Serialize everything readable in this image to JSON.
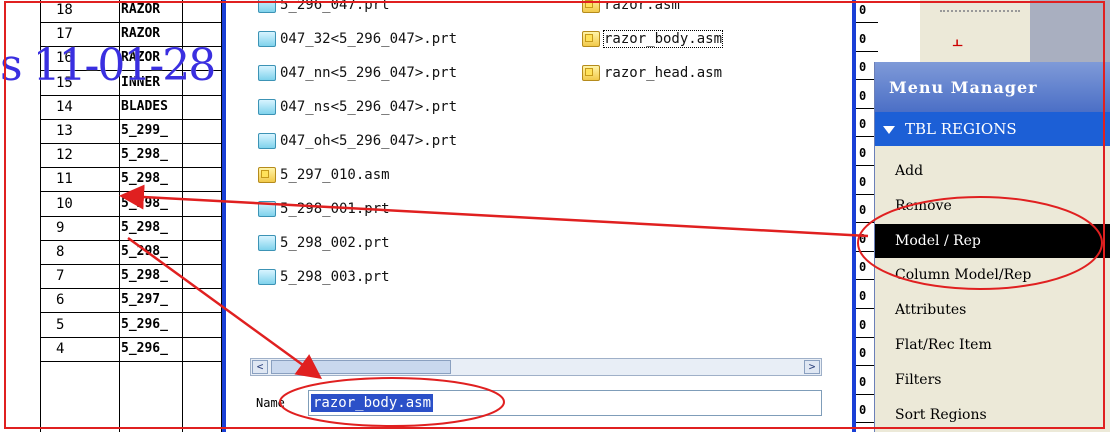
{
  "watermark": "s 11-01-28",
  "table_rows": [
    {
      "num": "18",
      "text": "RAZOR"
    },
    {
      "num": "17",
      "text": "RAZOR"
    },
    {
      "num": "16",
      "text": "RAZOR"
    },
    {
      "num": "15",
      "text": "INNER"
    },
    {
      "num": "14",
      "text": "BLADES"
    },
    {
      "num": "13",
      "text": "5_299_"
    },
    {
      "num": "12",
      "text": "5_298_"
    },
    {
      "num": "11",
      "text": "5_298_"
    },
    {
      "num": "10",
      "text": "5_298_"
    },
    {
      "num": "9",
      "text": "5_298_"
    },
    {
      "num": "8",
      "text": "5_298_"
    },
    {
      "num": "7",
      "text": "5_298_"
    },
    {
      "num": "6",
      "text": "5_297_"
    },
    {
      "num": "5",
      "text": "5_296_"
    },
    {
      "num": "4",
      "text": "5_296_"
    }
  ],
  "files_col1": [
    {
      "name": "5_296_047.prt",
      "type": "prt"
    },
    {
      "name": "047_32<5_296_047>.prt",
      "type": "prt"
    },
    {
      "name": "047_nn<5_296_047>.prt",
      "type": "prt"
    },
    {
      "name": "047_ns<5_296_047>.prt",
      "type": "prt"
    },
    {
      "name": "047_oh<5_296_047>.prt",
      "type": "prt"
    },
    {
      "name": "5_297_010.asm",
      "type": "asm"
    },
    {
      "name": "5_298_001.prt",
      "type": "prt"
    },
    {
      "name": "5_298_002.prt",
      "type": "prt"
    },
    {
      "name": "5_298_003.prt",
      "type": "prt"
    }
  ],
  "files_col2": [
    {
      "name": "razor.asm",
      "type": "asm"
    },
    {
      "name": "razor_body.asm",
      "type": "asm"
    },
    {
      "name": "razor_head.asm",
      "type": "asm"
    }
  ],
  "name_field": {
    "label": "Name",
    "value": "razor_body.asm"
  },
  "right_col_digits": [
    "0",
    "0",
    "0",
    "0",
    "0",
    "0",
    "0",
    "0",
    "0",
    "0",
    "0",
    "0",
    "0",
    "0",
    "0"
  ],
  "menu": {
    "title": "Menu Manager",
    "section": "TBL REGIONS",
    "items": [
      "Add",
      "Remove",
      "Model / Rep",
      "Column Model/Rep",
      "Attributes",
      "Flat/Rec Item",
      "Filters",
      "Sort Regions"
    ],
    "highlighted_index": 2
  },
  "colors": {
    "accent": "#1c5fd6",
    "annotation": "#e02020"
  },
  "scroll": {
    "left": "<",
    "right": ">"
  }
}
